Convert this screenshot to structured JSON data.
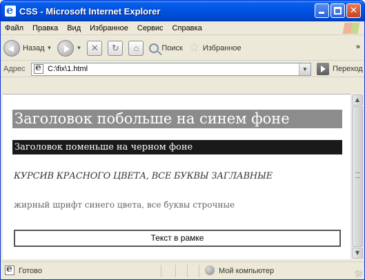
{
  "window": {
    "title": "CSS - Microsoft Internet Explorer"
  },
  "menu": {
    "items": [
      "Файл",
      "Правка",
      "Вид",
      "Избранное",
      "Сервис",
      "Справка"
    ]
  },
  "toolbar": {
    "back_label": "Назад",
    "search_label": "Поиск",
    "favorites_label": "Избранное",
    "more": "»"
  },
  "address": {
    "label": "Адрес",
    "value": "C:\\fix\\1.html",
    "go_label": "Переход"
  },
  "content": {
    "heading_blue": "Заголовок побольше на синем фоне",
    "heading_black": "Заголовок поменьше на черном фоне",
    "italic_text": "КУРСИВ КРАСНОГО ЦВЕТА, ВСЕ БУКВЫ ЗАГЛАВНЫЕ",
    "small_text": "жирный шрифт синего цвета, все буквы строчные",
    "boxed_text": "Текст в рамке"
  },
  "status": {
    "left_text": "Готово",
    "zone_text": "Мой компьютер"
  },
  "colors": {
    "titlebar": "#0054e3",
    "heading_bg": "#8c8c8c",
    "heading2_bg": "#1a1a1a"
  }
}
